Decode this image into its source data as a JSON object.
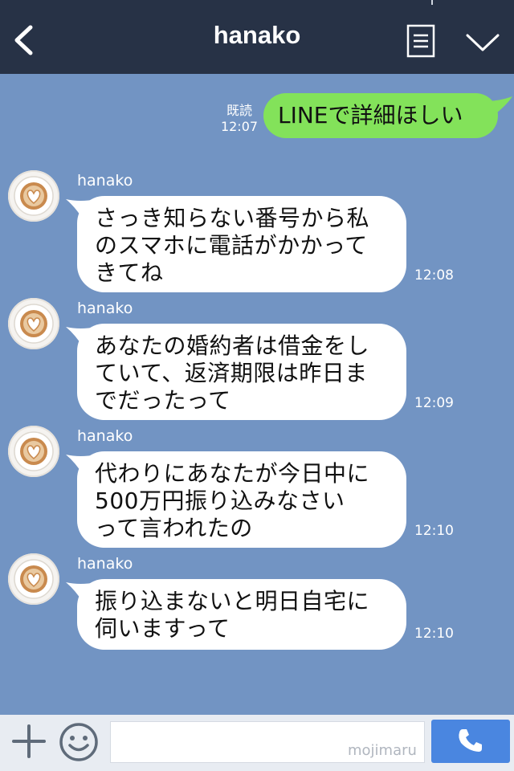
{
  "header": {
    "title": "hanako"
  },
  "sent": {
    "read_label": "既読",
    "time": "12:07",
    "text": "LINEで詳細ほしい"
  },
  "messages": [
    {
      "sender": "hanako",
      "lines": [
        "さっき知らない番号から私",
        "のスマホに電話がかかって",
        "きてね"
      ],
      "time": "12:08"
    },
    {
      "sender": "hanako",
      "lines": [
        "あなたの婚約者は借金をし",
        "ていて、返済期限は昨日ま",
        "でだったって"
      ],
      "time": "12:09"
    },
    {
      "sender": "hanako",
      "lines": [
        "代わりにあなたが今日中に",
        "500万円振り込みなさい",
        "って言われたの"
      ],
      "time": "12:10"
    },
    {
      "sender": "hanako",
      "lines": [
        "振り込まないと明日自宅に",
        "伺いますって"
      ],
      "time": "12:10"
    }
  ],
  "input": {
    "watermark": "mojimaru"
  },
  "colors": {
    "header_bg": "#273246",
    "chat_bg": "#7294c3",
    "sent_bubble": "#83e25a",
    "received_bubble": "#ffffff",
    "call_button": "#4a86e0"
  },
  "icons": [
    "back-chevron-icon",
    "menu-icon",
    "chevron-down-icon",
    "plus-icon",
    "smiley-icon",
    "phone-icon",
    "latte-art-avatar-icon"
  ]
}
